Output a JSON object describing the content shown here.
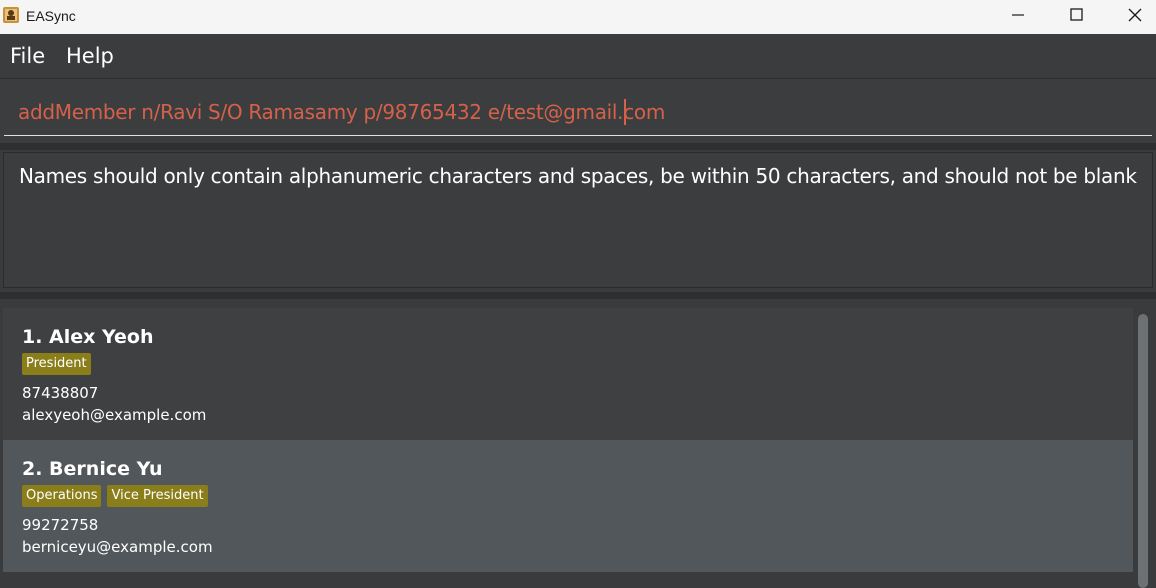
{
  "window": {
    "title": "EASync",
    "icon": "app-icon"
  },
  "menu": {
    "items": [
      "File",
      "Help"
    ]
  },
  "command": {
    "value": "addMember n/Ravi S/O Ramasamy p/98765432 e/test@gmail.com",
    "color": "#d6614a"
  },
  "result": {
    "text": "Names should only contain alphanumeric characters and spaces, be within 50 characters, and should not be blank"
  },
  "members": [
    {
      "name": "1. Alex Yeoh",
      "tags": [
        "President"
      ],
      "phone": "87438807",
      "email": "alexyeoh@example.com"
    },
    {
      "name": "2. Bernice Yu",
      "tags": [
        "Operations",
        "Vice President"
      ],
      "phone": "99272758",
      "email": "berniceyu@example.com"
    }
  ],
  "colors": {
    "tag": "#8a7e1a",
    "background": "#393b3d",
    "selected_card": "#51575a"
  }
}
